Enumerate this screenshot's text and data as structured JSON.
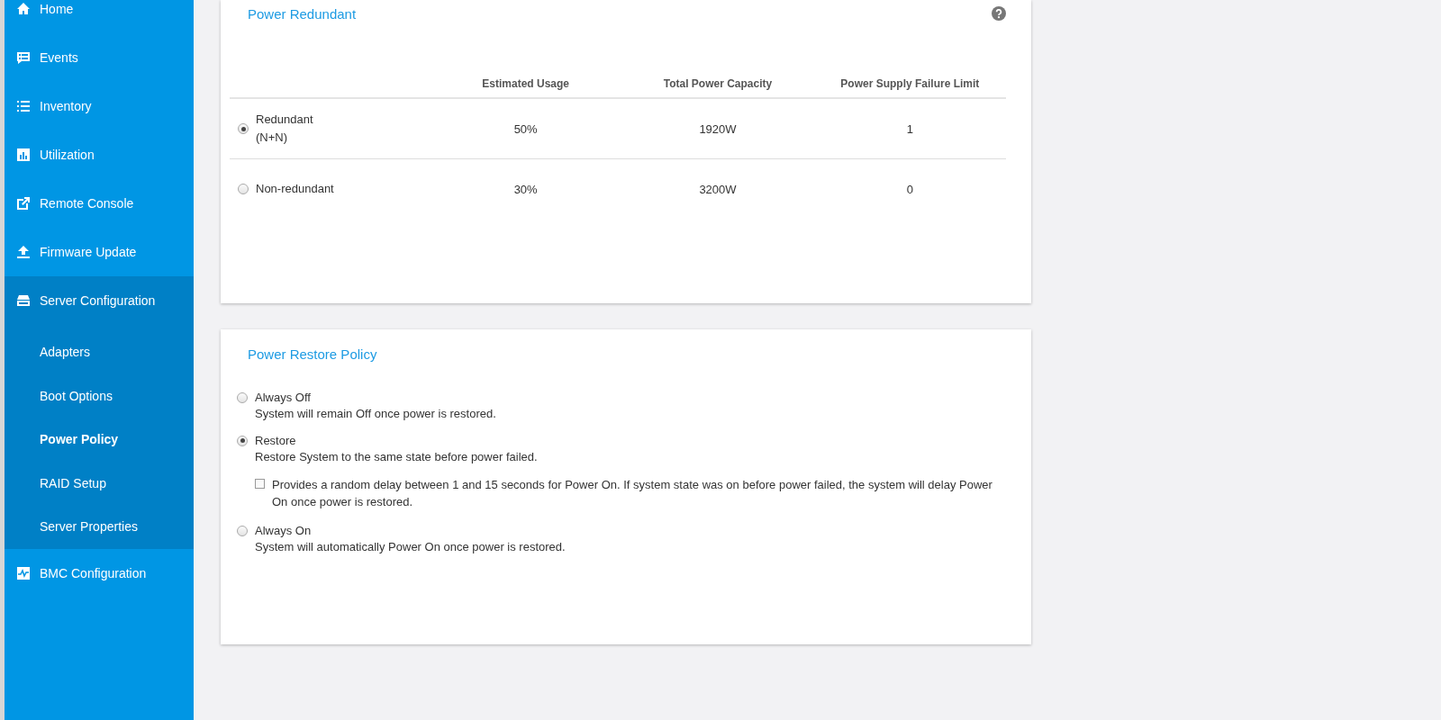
{
  "sidebar": {
    "items": [
      {
        "label": "Home"
      },
      {
        "label": "Events"
      },
      {
        "label": "Inventory"
      },
      {
        "label": "Utilization"
      },
      {
        "label": "Remote Console"
      },
      {
        "label": "Firmware Update"
      },
      {
        "label": "Server Configuration",
        "children": [
          {
            "label": "Adapters",
            "selected": false
          },
          {
            "label": "Boot Options",
            "selected": false
          },
          {
            "label": "Power Policy",
            "selected": true
          },
          {
            "label": "RAID Setup",
            "selected": false
          },
          {
            "label": "Server Properties",
            "selected": false
          }
        ]
      },
      {
        "label": "BMC Configuration"
      }
    ]
  },
  "power_redundant": {
    "title": "Power Redundant",
    "columns": [
      "Estimated Usage",
      "Total Power Capacity",
      "Power Supply Failure Limit"
    ],
    "rows": [
      {
        "label": "Redundant (N+N)",
        "selected": true,
        "cells": [
          "50%",
          "1920W",
          "1"
        ]
      },
      {
        "label": "Non-redundant",
        "selected": false,
        "cells": [
          "30%",
          "3200W",
          "0"
        ]
      }
    ]
  },
  "power_restore_policy": {
    "title": "Power Restore Policy",
    "options": [
      {
        "label": "Always Off",
        "description": "System will remain Off once power is restored.",
        "selected": false
      },
      {
        "label": "Restore",
        "description": "Restore System to the same state before power failed.",
        "selected": true,
        "delay": {
          "label": "Provides a random delay between 1 and 15 seconds for Power On. If system state was on before power failed, the system will delay Power On once power is restored.",
          "checked": false
        }
      },
      {
        "label": "Always On",
        "description": "System will automatically Power On once power is restored.",
        "selected": false
      }
    ]
  }
}
